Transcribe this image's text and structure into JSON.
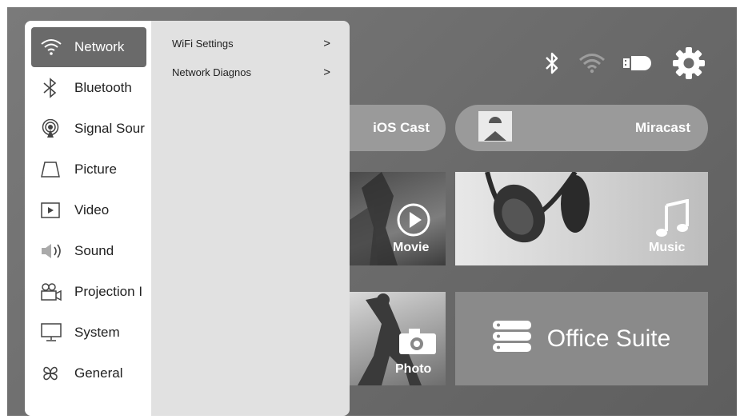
{
  "sidebar": {
    "items": [
      {
        "label": "Network",
        "icon": "wifi-icon",
        "active": true
      },
      {
        "label": "Bluetooth",
        "icon": "bluetooth-icon"
      },
      {
        "label": "Signal Sour",
        "icon": "signal-source-icon"
      },
      {
        "label": "Picture",
        "icon": "picture-icon"
      },
      {
        "label": "Video",
        "icon": "video-icon"
      },
      {
        "label": "Sound",
        "icon": "speaker-icon"
      },
      {
        "label": "Projection I",
        "icon": "projector-icon"
      },
      {
        "label": "System",
        "icon": "monitor-icon"
      },
      {
        "label": "General",
        "icon": "general-icon"
      }
    ]
  },
  "submenu": {
    "items": [
      {
        "label": "WiFi Settings",
        "chevron": ">"
      },
      {
        "label": "Network Diagnos",
        "chevron": ">"
      }
    ]
  },
  "status": {
    "icons": [
      "bluetooth-icon",
      "wifi-icon",
      "input-source-icon",
      "settings-gear-icon"
    ]
  },
  "home": {
    "ios_cast": "iOS Cast",
    "miracast": "Miracast",
    "movie": "Movie",
    "music": "Music",
    "photo": "Photo",
    "office": "Office Suite"
  },
  "colors": {
    "active_item": "#6a6a6a",
    "panel": "#e1e1e1",
    "background": "#6c6c6c"
  }
}
